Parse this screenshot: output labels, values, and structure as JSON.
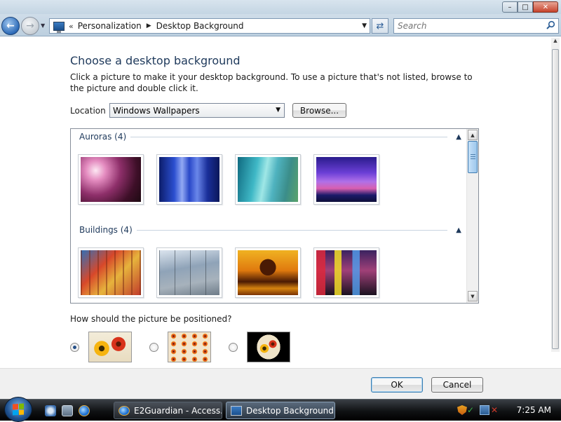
{
  "window": {
    "minimize": "–",
    "maximize": "□",
    "close": "✕"
  },
  "nav": {
    "back_icon": "back-arrow-icon",
    "forward_icon": "forward-arrow-icon",
    "chevrons": "«",
    "breadcrumb": [
      "Personalization",
      "Desktop Background"
    ],
    "search_placeholder": "Search"
  },
  "page": {
    "title": "Choose a desktop background",
    "description": "Click a picture to make it your desktop background. To use a picture that's not listed, browse to the picture and double click it.",
    "location_label": "Location",
    "location_value": "Windows Wallpapers",
    "browse_label": "Browse...",
    "groups": [
      {
        "title": "Auroras (4)",
        "thumbnails": [
          "aurora-pink",
          "aurora-blue",
          "aurora-teal",
          "aurora-purple"
        ]
      },
      {
        "title": "Buildings (4)",
        "thumbnails": [
          "building-glass",
          "building-windows",
          "taj-mahal",
          "city-signs"
        ]
      }
    ],
    "position_question": "How should the picture be positioned?",
    "position_options": [
      {
        "name": "fit-to-screen",
        "selected": true
      },
      {
        "name": "tile",
        "selected": false
      },
      {
        "name": "center",
        "selected": false
      }
    ]
  },
  "footer": {
    "ok_label": "OK",
    "cancel_label": "Cancel"
  },
  "taskbar": {
    "tasks": [
      {
        "label": "E2Guardian - Access...",
        "active": false
      },
      {
        "label": "Desktop Background",
        "active": true
      }
    ],
    "clock": "7:25 AM"
  },
  "colors": {
    "heading": "#1e395b",
    "accent": "#2d6bb8"
  }
}
